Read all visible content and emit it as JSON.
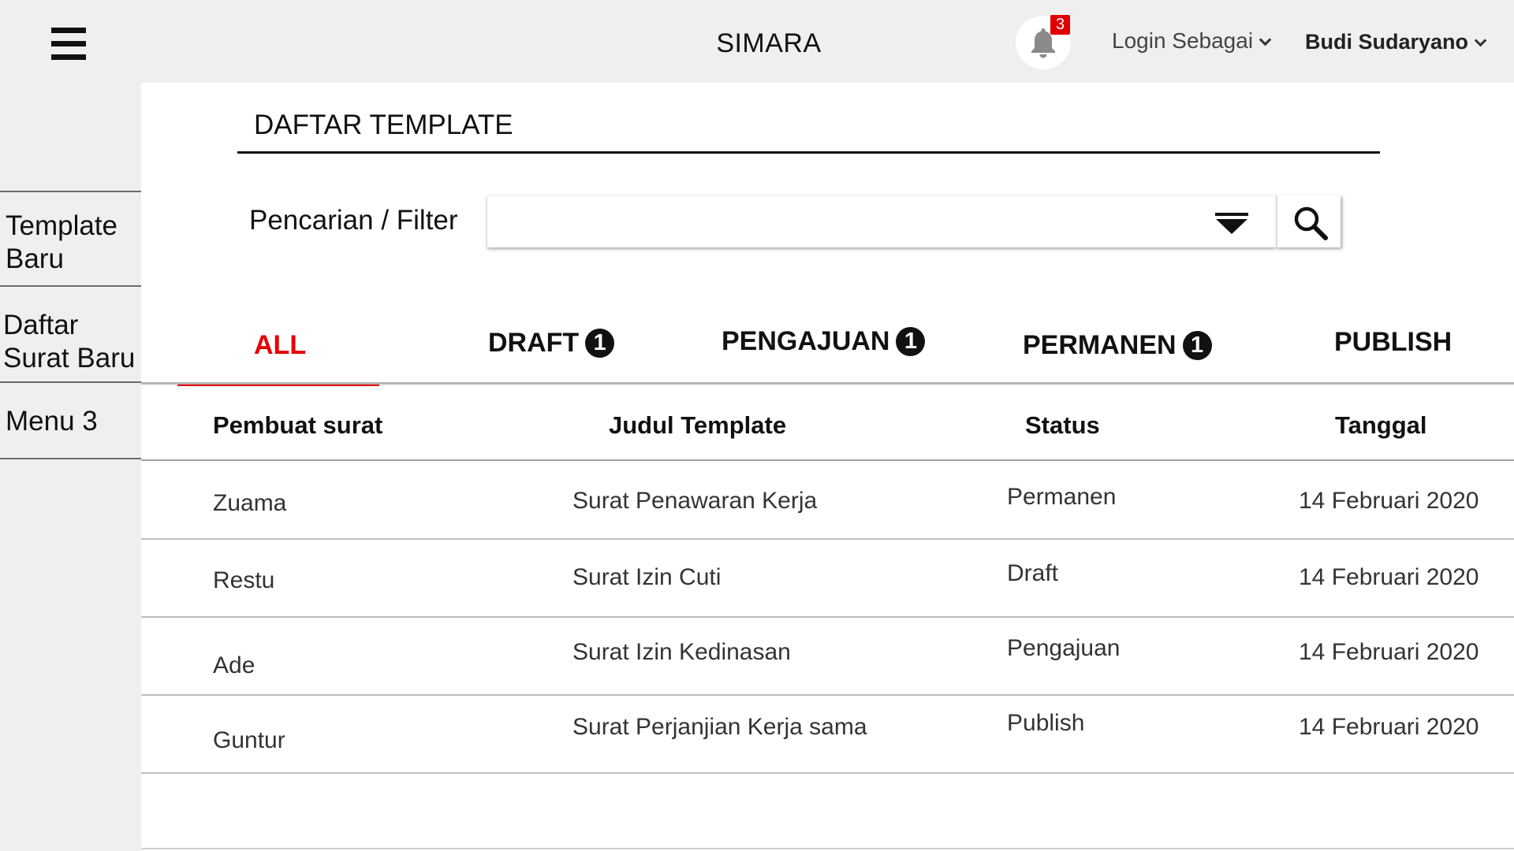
{
  "header": {
    "app_title": "SIMARA",
    "notification_count": "3",
    "login_as_label": "Login Sebagai",
    "user_name": "Budi Sudaryano"
  },
  "sidebar": {
    "items": [
      {
        "label": "Template Baru"
      },
      {
        "label": "Daftar Surat Baru"
      },
      {
        "label": "Menu 3"
      }
    ]
  },
  "main": {
    "title": "DAFTAR TEMPLATE",
    "filter": {
      "label": "Pencarian / Filter",
      "value": "",
      "placeholder": ""
    },
    "tabs": [
      {
        "label": "ALL",
        "count": null,
        "active": true
      },
      {
        "label": "DRAFT",
        "count": "1"
      },
      {
        "label": "PENGAJUAN",
        "count": "1"
      },
      {
        "label": "PERMANEN",
        "count": "1"
      },
      {
        "label": "PUBLISH",
        "count": null
      }
    ],
    "table": {
      "columns": [
        "Pembuat surat",
        "Judul Template",
        "Status",
        "Tanggal"
      ],
      "rows": [
        {
          "author": "Zuama",
          "title": "Surat Penawaran Kerja",
          "status": "Permanen",
          "date": "14 Februari 2020"
        },
        {
          "author": "Restu",
          "title": "Surat Izin Cuti",
          "status": "Draft",
          "date": "14 Februari 2020"
        },
        {
          "author": "Ade",
          "title": "Surat Izin Kedinasan",
          "status": "Pengajuan",
          "date": "14 Februari 2020"
        },
        {
          "author": "Guntur",
          "title": "Surat Perjanjian Kerja sama",
          "status": "Publish",
          "date": "14 Februari 2020"
        }
      ]
    }
  },
  "colors": {
    "background": "#efefef",
    "content": "#ffffff",
    "accent": "#e60000",
    "badge": "#e10000"
  },
  "icons": {
    "menu": "hamburger-icon",
    "notifications": "bell-icon",
    "dropdown": "chevron-down-icon",
    "filter_dropdown": "caret-down-icon",
    "search": "search-icon"
  }
}
